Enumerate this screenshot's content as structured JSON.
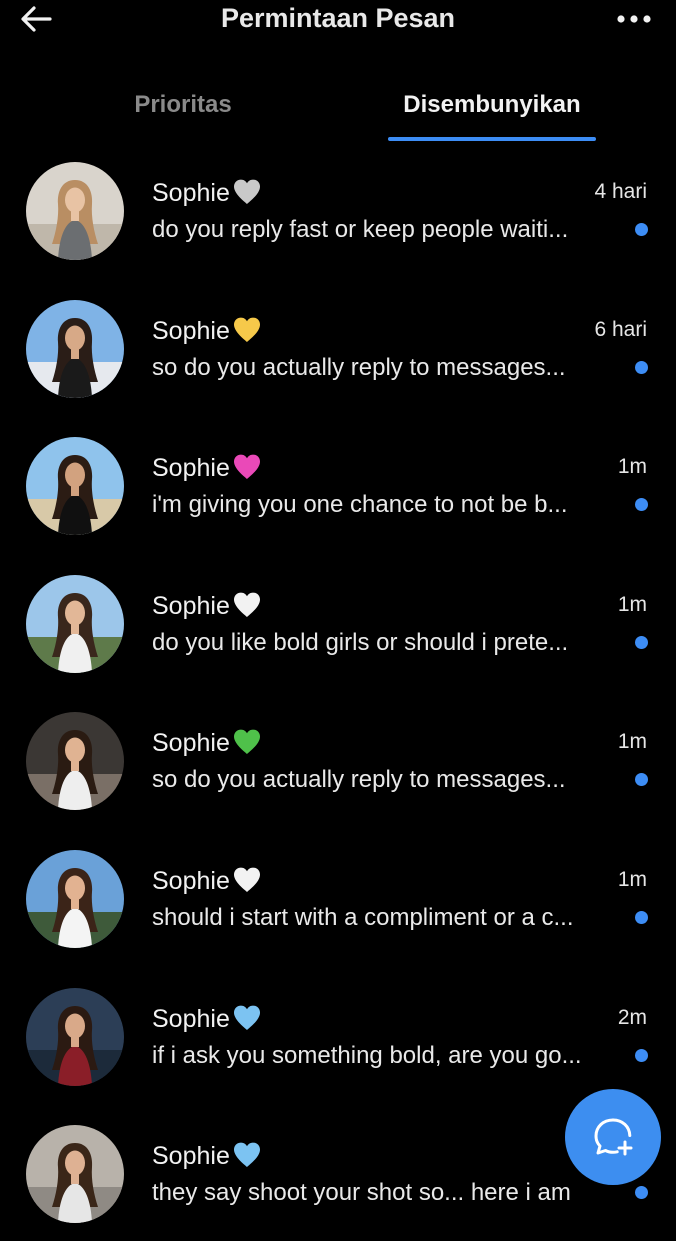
{
  "header": {
    "title": "Permintaan Pesan",
    "back_icon": "arrow-left-icon",
    "more_icon": "more-horizontal-icon"
  },
  "tabs": [
    {
      "label": "Prioritas",
      "active": false
    },
    {
      "label": "Disembunyikan",
      "active": true
    }
  ],
  "colors": {
    "accent": "#3d8df5",
    "background": "#000000"
  },
  "messages": [
    {
      "name": "Sophie",
      "heart": "white-heart-icon",
      "heart_color": "#c9c9c9",
      "time": "4 hari",
      "preview": "do you reply fast or keep people waiti...",
      "unread": true
    },
    {
      "name": "Sophie",
      "heart": "yellow-heart-icon",
      "heart_color": "#f6c94a",
      "time": "6 hari",
      "preview": "so do you actually reply to messages...",
      "unread": true
    },
    {
      "name": "Sophie",
      "heart": "pink-heart-icon",
      "heart_color": "#ea49b8",
      "time": "1m",
      "preview": "i'm giving you one chance to not be b...",
      "unread": true
    },
    {
      "name": "Sophie",
      "heart": "white-heart-icon",
      "heart_color": "#f2f2f2",
      "time": "1m",
      "preview": "do you like bold girls or should i prete...",
      "unread": true
    },
    {
      "name": "Sophie",
      "heart": "green-heart-icon",
      "heart_color": "#4fc14a",
      "time": "1m",
      "preview": "so do you actually reply to messages...",
      "unread": true
    },
    {
      "name": "Sophie",
      "heart": "white-heart-icon",
      "heart_color": "#f2f2f2",
      "time": "1m",
      "preview": "should i start with a compliment or a c...",
      "unread": true
    },
    {
      "name": "Sophie",
      "heart": "light-blue-heart-icon",
      "heart_color": "#7cc3f2",
      "time": "2m",
      "preview": "if i ask you something bold, are you go...",
      "unread": true
    },
    {
      "name": "Sophie",
      "heart": "light-blue-heart-icon",
      "heart_color": "#7cc3f2",
      "time": "",
      "preview": "they say shoot your shot so... here i am",
      "unread": true
    }
  ],
  "fab": {
    "icon": "new-message-icon"
  }
}
